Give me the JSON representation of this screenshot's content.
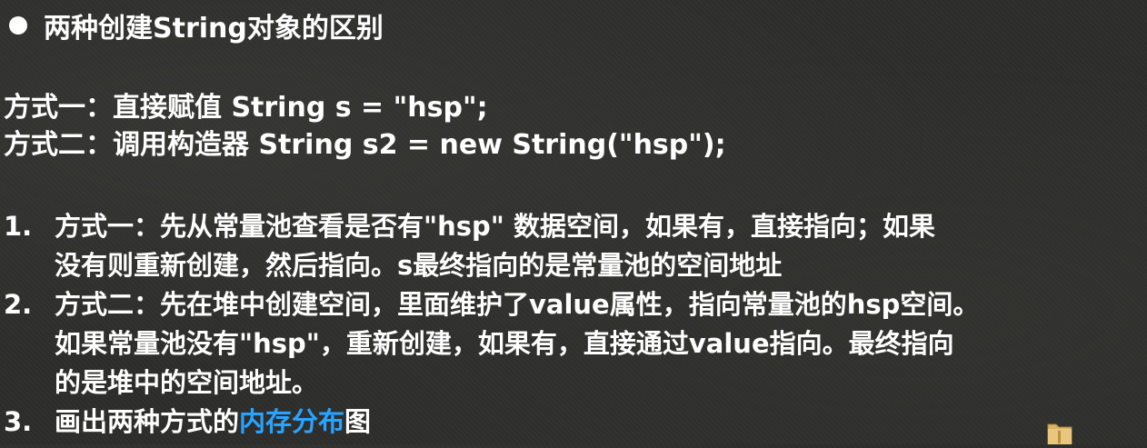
{
  "title": "两种创建String对象的区别",
  "methods": [
    "方式一：直接赋值 String s = \"hsp\";",
    "方式二：调用构造器 String s2 = new String(\"hsp\");"
  ],
  "items": [
    {
      "num": "1.",
      "lines": [
        "方式一：先从常量池查看是否有\"hsp\" 数据空间，如果有，直接指向；如果",
        "没有则重新创建，然后指向。s最终指向的是常量池的空间地址"
      ]
    },
    {
      "num": "2.",
      "lines": [
        "方式二：先在堆中创建空间，里面维护了value属性，指向常量池的hsp空间。",
        "如果常量池没有\"hsp\"，重新创建，如果有，直接通过value指向。最终指向",
        "的是堆中的空间地址。"
      ]
    },
    {
      "num": "3.",
      "text_before": "画出两种方式的",
      "highlight": "内存分布",
      "text_after": "图"
    }
  ],
  "colors": {
    "background": "#2d2d2b",
    "text": "#ffffff",
    "highlight": "#2aa3ff"
  },
  "icons": {
    "bullet": "filled-circle",
    "corner": "folder-icon"
  }
}
